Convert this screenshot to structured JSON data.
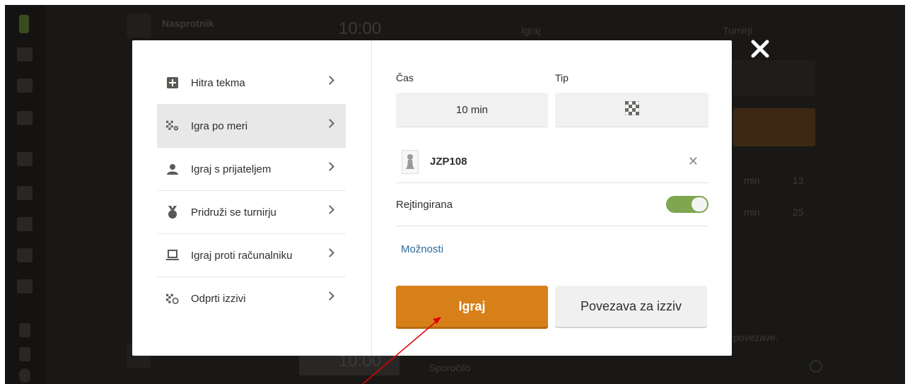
{
  "background": {
    "opponent_label": "Nasprotnik",
    "clock_top": "10:00",
    "tab_play": "Igraj",
    "tab_tournaments": "Turnirji",
    "clock_bottom": "10:00",
    "message_placeholder": "Sporočilo",
    "side_stat_1": "13",
    "side_stat_2": "25",
    "side_text_1": "min",
    "side_text_2": "min",
    "side_link_fragment": "povezave."
  },
  "menu": {
    "items": [
      {
        "label": "Hitra tekma",
        "icon": "plus-square-icon"
      },
      {
        "label": "Igra po meri",
        "icon": "board-gear-icon"
      },
      {
        "label": "Igraj s prijateljem",
        "icon": "person-icon"
      },
      {
        "label": "Pridruži se turnirju",
        "icon": "medal-icon"
      },
      {
        "label": "Igraj proti računalniku",
        "icon": "laptop-icon"
      },
      {
        "label": "Odprti izzivi",
        "icon": "board-circle-icon"
      }
    ],
    "active_index": 1
  },
  "custom_game": {
    "time_label": "Čas",
    "type_label": "Tip",
    "time_value": "10 min",
    "type_value_icon": "checkerboard-icon",
    "opponent_username": "JZP108",
    "rated_label": "Rejtingirana",
    "rated_on": true,
    "options_link": "Možnosti",
    "play_button": "Igraj",
    "challenge_link_button": "Povezava za izziv"
  },
  "colors": {
    "accent_orange": "#d7801a",
    "toggle_green": "#7fa650",
    "link_blue": "#2b6d9c",
    "annotation_red": "#e00000"
  }
}
